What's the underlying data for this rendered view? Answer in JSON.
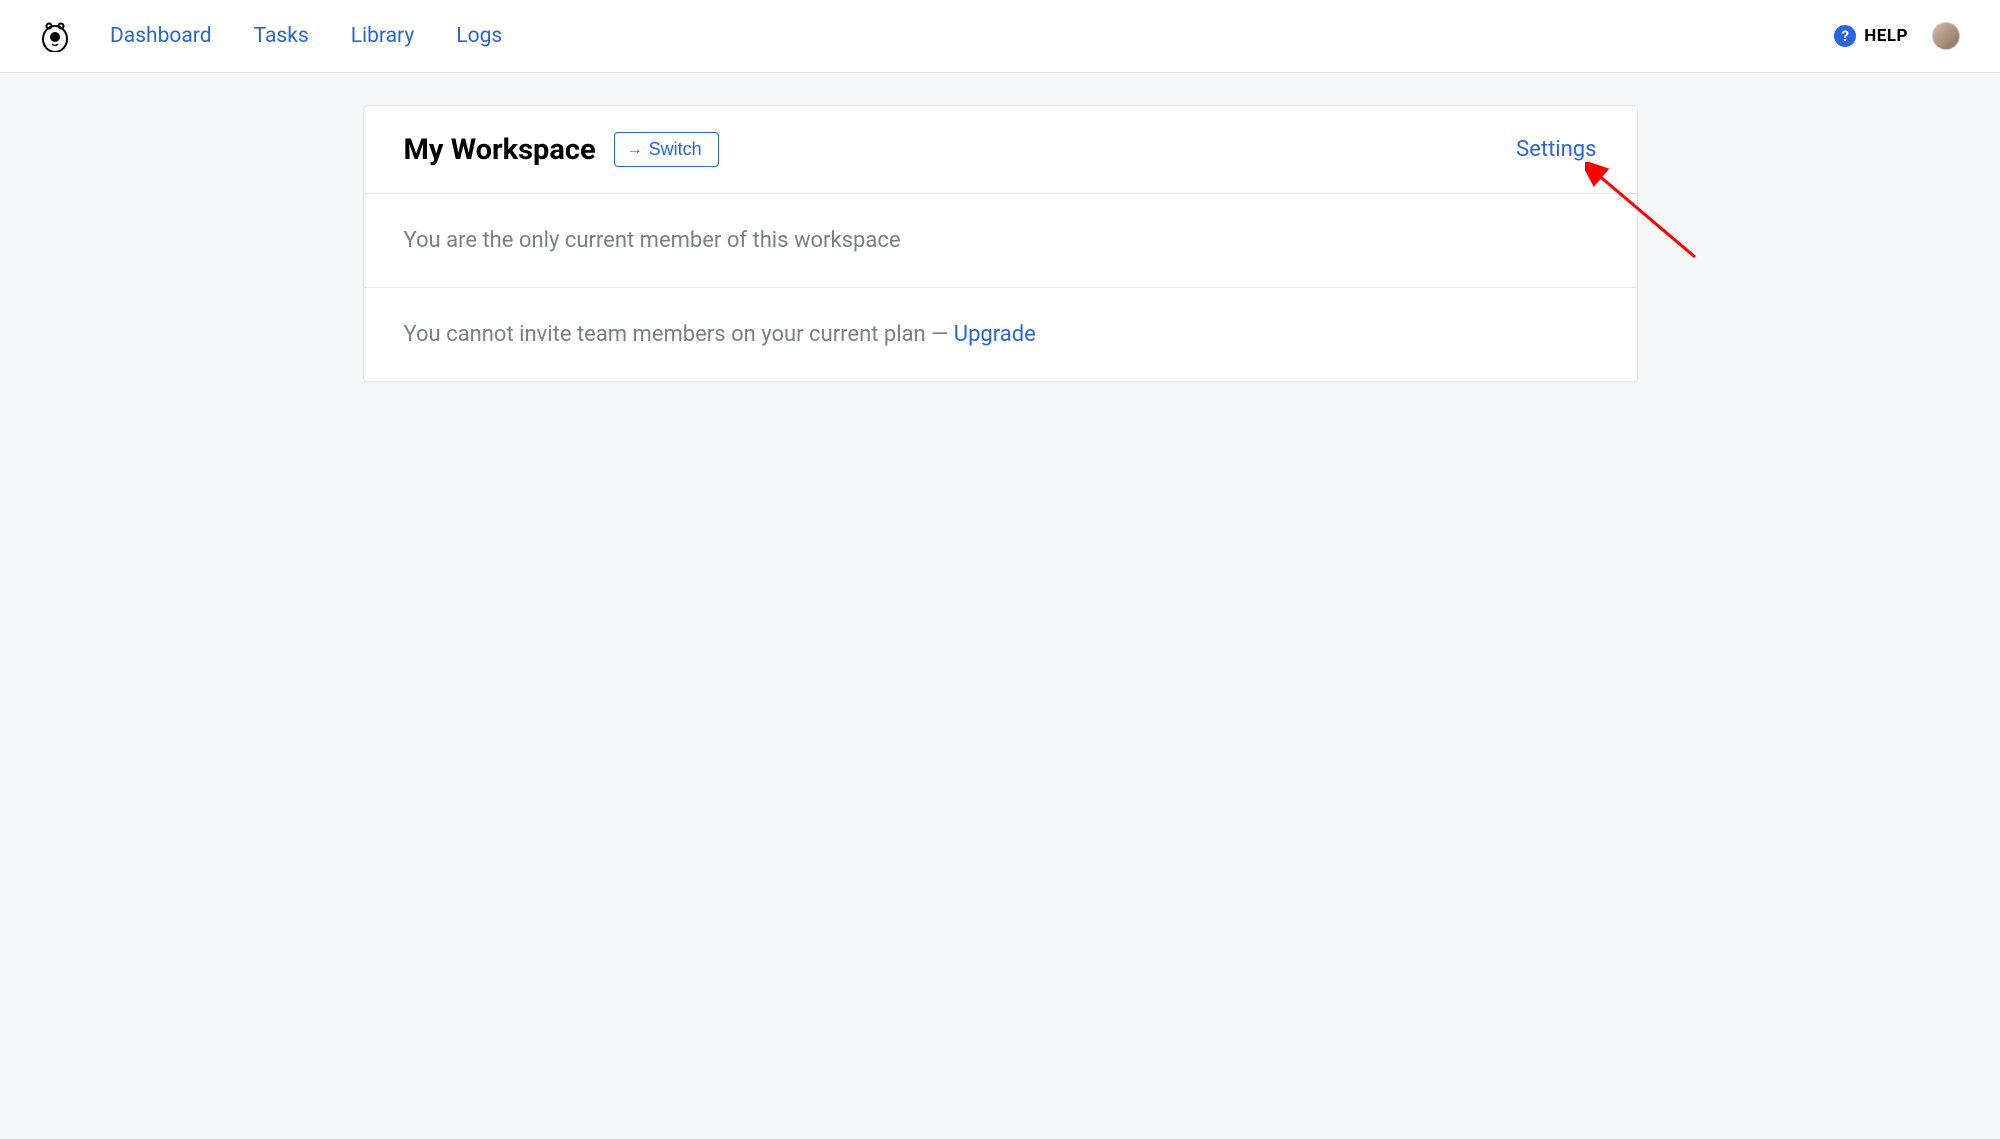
{
  "nav": {
    "links": {
      "dashboard": "Dashboard",
      "tasks": "Tasks",
      "library": "Library",
      "logs": "Logs"
    },
    "help_label": "HELP"
  },
  "workspace": {
    "title": "My Workspace",
    "switch_label": "Switch",
    "settings_label": "Settings",
    "member_status": "You are the only current member of this workspace",
    "invite_prefix": "You cannot invite team members on your current plan — ",
    "upgrade_label": "Upgrade"
  }
}
